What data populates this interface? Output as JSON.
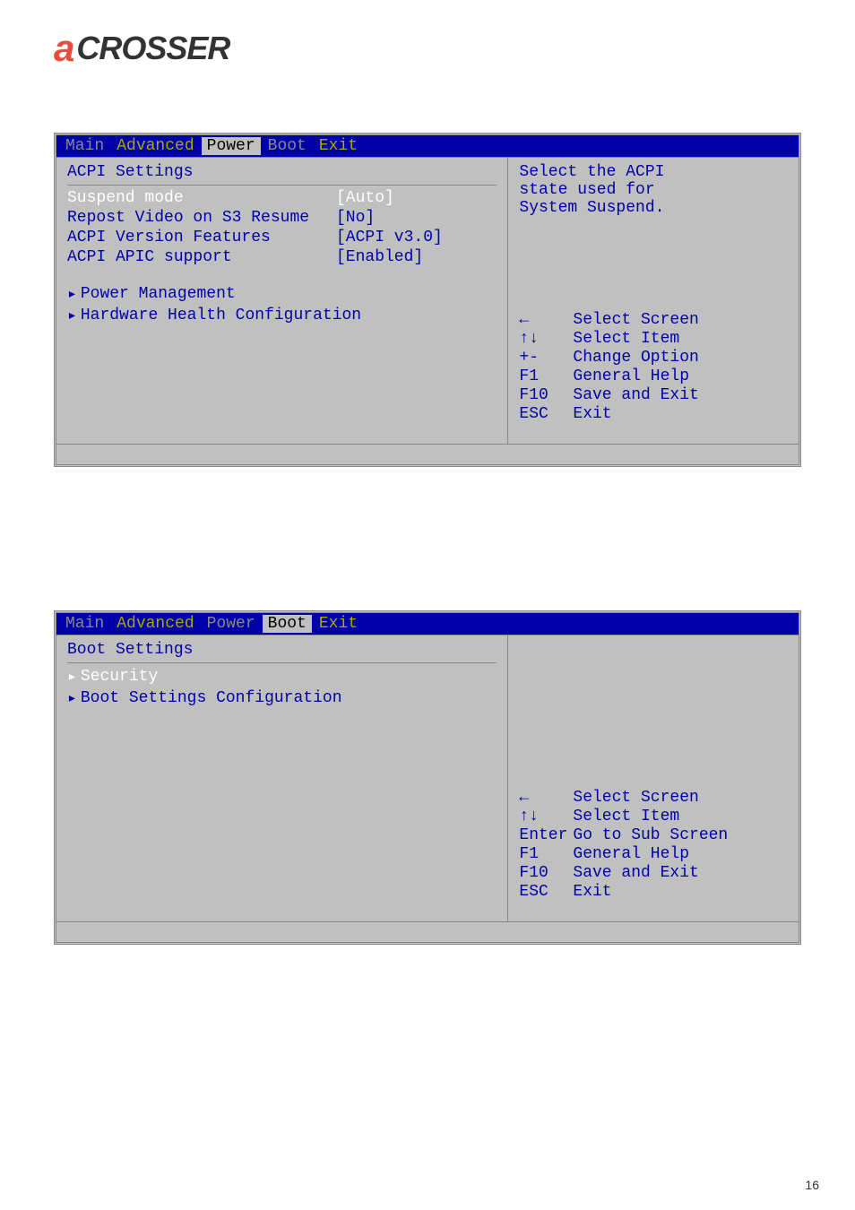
{
  "logo": {
    "letter": "a",
    "text": "CROSSER"
  },
  "bios1": {
    "tabs": {
      "main": "Main",
      "advanced": "Advanced",
      "power": "Power",
      "boot": "Boot",
      "exit": "Exit"
    },
    "section_title": "ACPI Settings",
    "settings": {
      "suspend_mode": {
        "label": "Suspend mode",
        "value": "[Auto]"
      },
      "repost_video": {
        "label": "Repost Video on S3 Resume",
        "value": "[No]"
      },
      "acpi_version": {
        "label": "ACPI Version Features",
        "value": "[ACPI v3.0]"
      },
      "acpi_apic": {
        "label": "ACPI APIC support",
        "value": "[Enabled]"
      }
    },
    "submenus": {
      "power_mgmt": "Power Management",
      "hardware_health": "Hardware Health Configuration"
    },
    "help": {
      "line1": "Select the ACPI",
      "line2": "state used for",
      "line3": "System Suspend."
    },
    "keys": {
      "k1": {
        "key": "←",
        "desc": "Select Screen"
      },
      "k2": {
        "key": "↑↓",
        "desc": "Select Item"
      },
      "k3": {
        "key": "+-",
        "desc": "Change Option"
      },
      "k4": {
        "key": "F1",
        "desc": "General Help"
      },
      "k5": {
        "key": "F10",
        "desc": "Save and Exit"
      },
      "k6": {
        "key": "ESC",
        "desc": "Exit"
      }
    }
  },
  "bios2": {
    "tabs": {
      "main": "Main",
      "advanced": "Advanced",
      "power": "Power",
      "boot": "Boot",
      "exit": "Exit"
    },
    "section_title": "Boot Settings",
    "submenus": {
      "security": "Security",
      "boot_settings_config": "Boot Settings Configuration"
    },
    "keys": {
      "k1": {
        "key": "←",
        "desc": "Select Screen"
      },
      "k2": {
        "key": "↑↓",
        "desc": "Select Item"
      },
      "k3": {
        "key": "Enter",
        "desc": "Go to Sub Screen"
      },
      "k4": {
        "key": "F1",
        "desc": "General Help"
      },
      "k5": {
        "key": "F10",
        "desc": "Save and Exit"
      },
      "k6": {
        "key": "ESC",
        "desc": "Exit"
      }
    }
  },
  "page_number": "16"
}
